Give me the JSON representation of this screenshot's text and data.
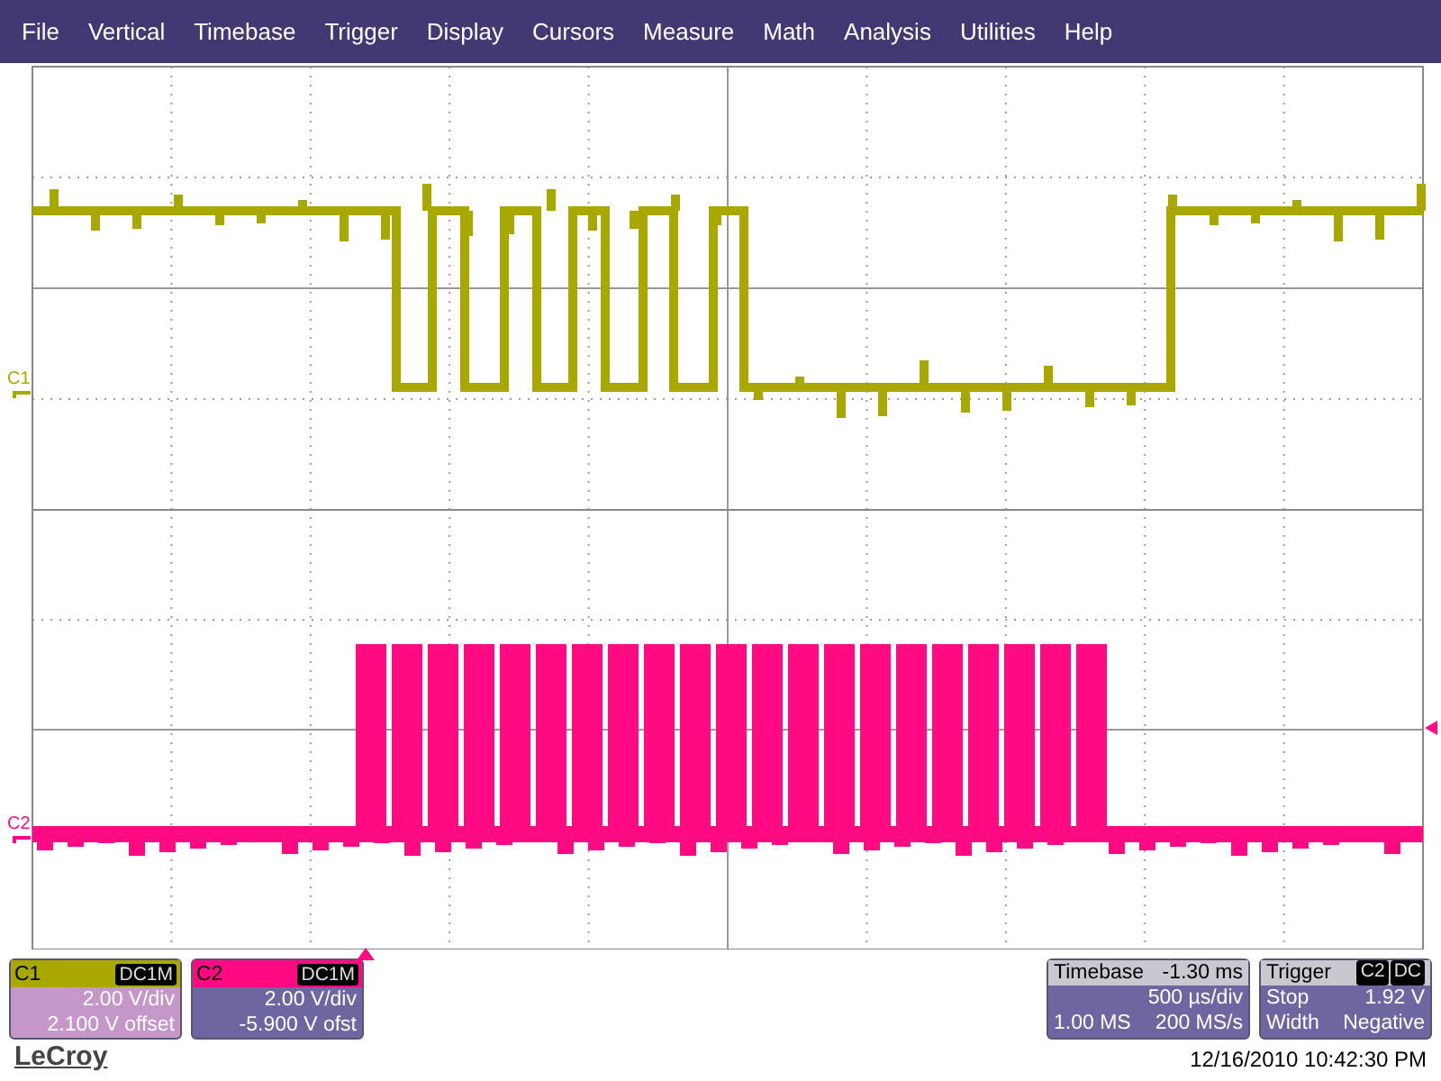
{
  "menu": [
    "File",
    "Vertical",
    "Timebase",
    "Trigger",
    "Display",
    "Cursors",
    "Measure",
    "Math",
    "Analysis",
    "Utilities",
    "Help"
  ],
  "plot": {
    "markers": [
      "C1",
      "C2"
    ]
  },
  "channels": [
    {
      "name": "C1",
      "coupling": "DC1M",
      "color": "#a8a800",
      "selected": true,
      "scale": "2.00 V/div",
      "offset": "2.100 V offset"
    },
    {
      "name": "C2",
      "coupling": "DC1M",
      "color": "#ff0a82",
      "selected": false,
      "scale": "2.00 V/div",
      "offset": "-5.900 V ofst"
    }
  ],
  "timebase": {
    "title": "Timebase",
    "delay": "-1.30 ms",
    "scale": "500 µs/div",
    "samples": "1.00 MS",
    "rate": "200 MS/s"
  },
  "trigger": {
    "title": "Trigger",
    "source": "C2",
    "coupling": "DC",
    "mode": "Stop",
    "level": "1.92 V",
    "type": "Width",
    "slope": "Negative"
  },
  "logo": "LeCroy",
  "timestamp": "12/16/2010 10:42:30 PM"
}
